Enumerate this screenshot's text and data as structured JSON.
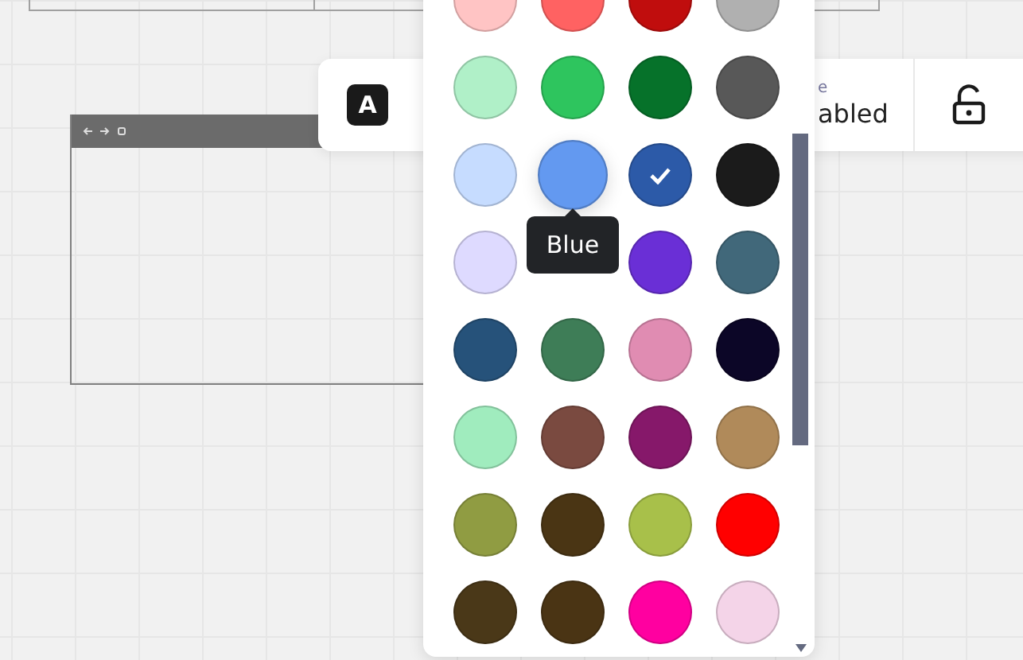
{
  "toolbar": {
    "text_tool": {
      "glyph": "A"
    },
    "setting": {
      "label": "e",
      "value": "abled"
    },
    "lock": {
      "locked": false
    }
  },
  "palette": {
    "swatches": [
      {
        "kind": "swatch",
        "color": "#ffc4c4",
        "selected": false
      },
      {
        "kind": "swatch",
        "color": "#ff6262",
        "selected": false
      },
      {
        "kind": "swatch",
        "color": "#c00d0d",
        "selected": false
      },
      {
        "kind": "swatch",
        "color": "#b0b0b0",
        "selected": false
      },
      {
        "kind": "swatch",
        "color": "#b0f0c8",
        "selected": false
      },
      {
        "kind": "swatch",
        "color": "#2ec55e",
        "selected": false
      },
      {
        "kind": "swatch",
        "color": "#06722a",
        "selected": false
      },
      {
        "kind": "swatch",
        "color": "#585858",
        "selected": false
      },
      {
        "kind": "swatch",
        "color": "#c6dcff",
        "selected": false
      },
      {
        "kind": "swatch",
        "color": "#6399f0",
        "selected": false,
        "tooltip": "Blue"
      },
      {
        "kind": "swatch",
        "color": "#2c5aa8",
        "selected": true
      },
      {
        "kind": "swatch",
        "color": "#1b1b1b",
        "selected": false
      },
      {
        "kind": "swatch",
        "color": "#dedaff",
        "selected": false
      },
      {
        "kind": "covered"
      },
      {
        "kind": "swatch",
        "color": "#6a2fd6",
        "selected": false
      },
      {
        "kind": "swatch",
        "color": "#41687a",
        "selected": false
      },
      {
        "kind": "swatch",
        "color": "#26527a",
        "selected": false
      },
      {
        "kind": "swatch",
        "color": "#3e7d57",
        "selected": false
      },
      {
        "kind": "swatch",
        "color": "#e08cb2",
        "selected": false
      },
      {
        "kind": "swatch",
        "color": "#0c0627",
        "selected": false
      },
      {
        "kind": "swatch",
        "color": "#a0ecbe",
        "selected": false
      },
      {
        "kind": "swatch",
        "color": "#7a4a40",
        "selected": false
      },
      {
        "kind": "swatch",
        "color": "#86186a",
        "selected": false
      },
      {
        "kind": "swatch",
        "color": "#b08a5a",
        "selected": false
      },
      {
        "kind": "swatch",
        "color": "#909c42",
        "selected": false
      },
      {
        "kind": "swatch",
        "color": "#4a3514",
        "selected": false
      },
      {
        "kind": "swatch",
        "color": "#a8c04a",
        "selected": false
      },
      {
        "kind": "swatch",
        "color": "#ff0000",
        "selected": false
      },
      {
        "kind": "swatch",
        "color": "#4a3818",
        "selected": false
      },
      {
        "kind": "swatch",
        "color": "#4a3414",
        "selected": false
      },
      {
        "kind": "swatch",
        "color": "#ff00a0",
        "selected": false
      },
      {
        "kind": "swatch",
        "color": "#f4d4e8",
        "selected": false
      }
    ]
  }
}
